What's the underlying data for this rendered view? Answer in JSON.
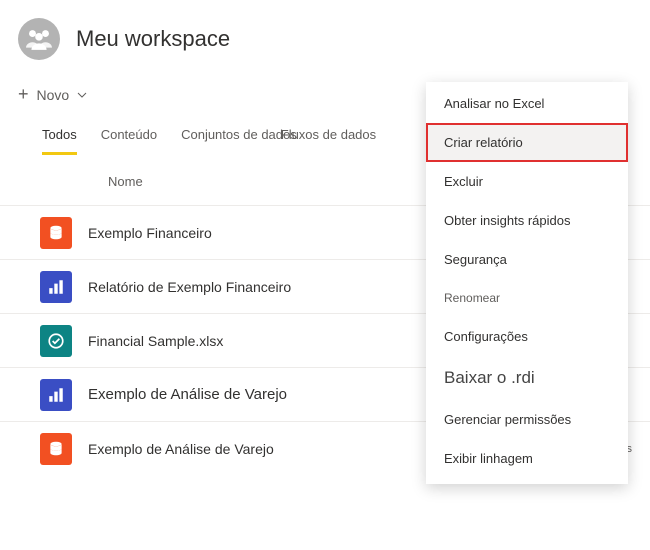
{
  "header": {
    "title": "Meu workspace"
  },
  "toolbar": {
    "new_label": "Novo"
  },
  "tabs": {
    "all": "Todos",
    "content": "Conteúdo",
    "datasets": "Conjuntos de dados",
    "dataflows": "Fluxos de dados"
  },
  "columns": {
    "name": "Nome"
  },
  "items": [
    {
      "label": "Exemplo Financeiro",
      "type": "dataset"
    },
    {
      "label": "Relatório de Exemplo Financeiro",
      "type": "report"
    },
    {
      "label": "Financial Sample.xlsx",
      "type": "excel"
    },
    {
      "label": "Exemplo de Análise de Varejo",
      "type": "report"
    },
    {
      "label": "Exemplo de Análise de Varejo",
      "type": "dataset",
      "type_label": "Conjunto de dados"
    }
  ],
  "menu": {
    "analyze_excel": "Analisar no Excel",
    "create_report": "Criar relatório",
    "delete": "Excluir",
    "quick_insights": "Obter insights rápidos",
    "security": "Segurança",
    "rename": "Renomear",
    "settings": "Configurações",
    "download_rdi": "Baixar o .rdi",
    "manage_permissions": "Gerenciar permissões",
    "view_lineage": "Exibir linhagem"
  }
}
